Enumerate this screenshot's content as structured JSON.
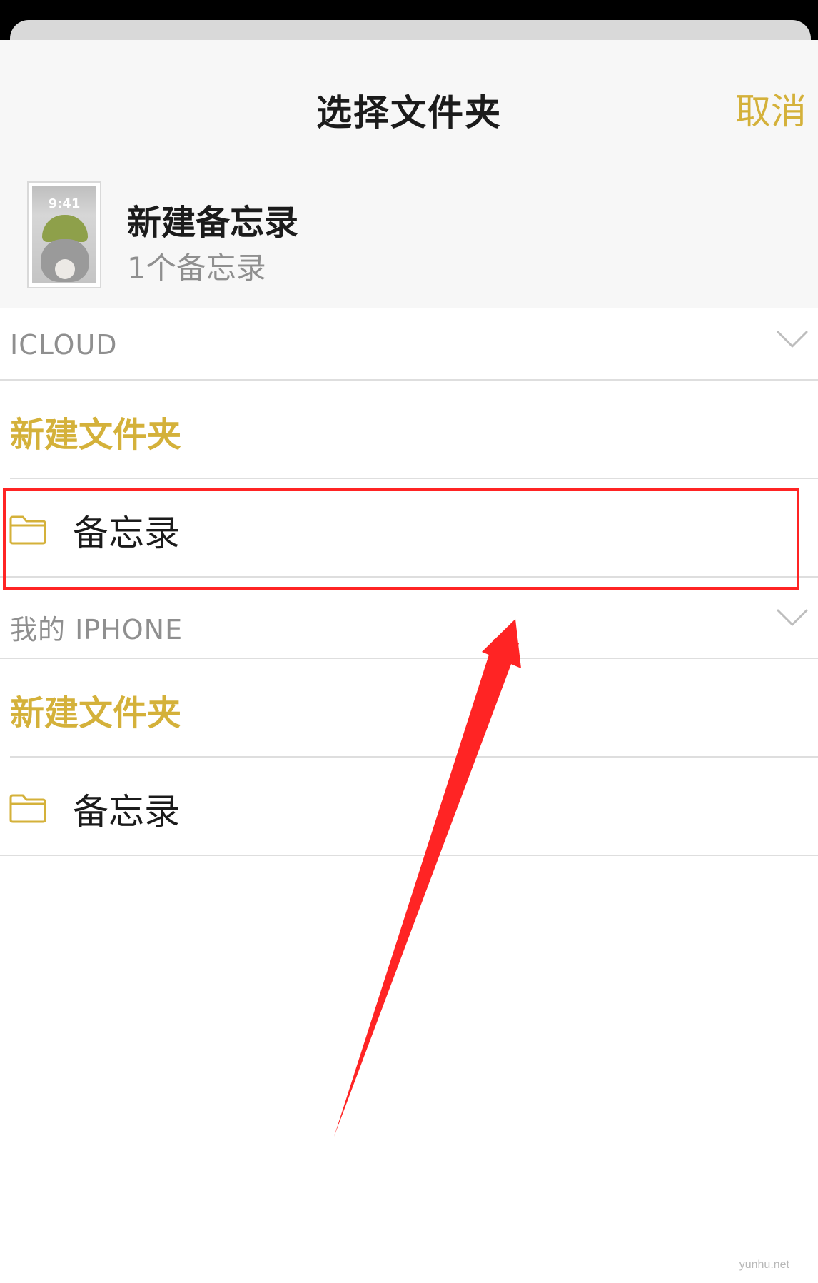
{
  "header": {
    "title": "选择文件夹",
    "cancel_label": "取消",
    "note": {
      "title": "新建备忘录",
      "count": "1个备忘录",
      "thumbnail_time": "9:41"
    }
  },
  "sections": [
    {
      "label": "ICLOUD",
      "new_folder_label": "新建文件夹",
      "folders": [
        {
          "label": "备忘录",
          "icon": "folder-icon"
        }
      ]
    },
    {
      "label": "我的 IPHONE",
      "new_folder_label": "新建文件夹",
      "folders": [
        {
          "label": "备忘录",
          "icon": "folder-icon"
        }
      ]
    }
  ],
  "watermark": "yunhu.net",
  "colors": {
    "accent": "#d4b13a",
    "annotation": "#ff2424",
    "text_primary": "#1b1b1b",
    "text_secondary": "#8f8f8f"
  }
}
